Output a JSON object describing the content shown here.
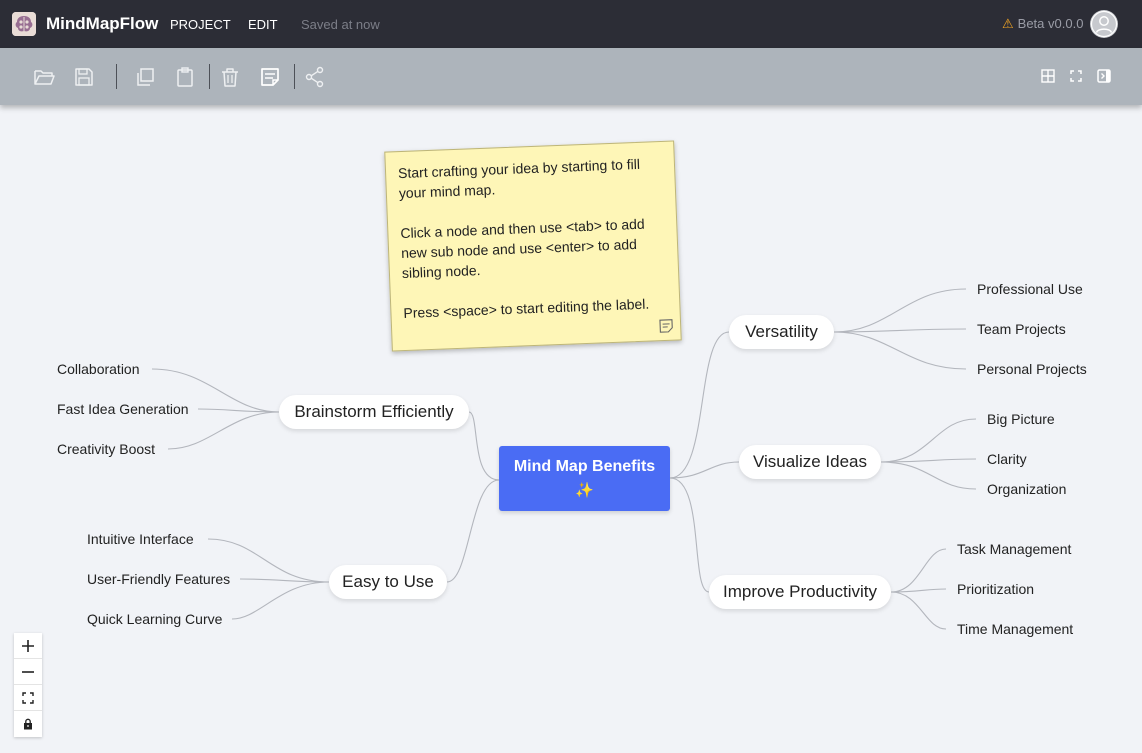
{
  "header": {
    "app_name": "MindMapFlow",
    "menu": [
      "PROJECT",
      "EDIT"
    ],
    "save_status": "Saved at now",
    "version": "Beta v0.0.0"
  },
  "toolbar": {
    "left_icons": [
      "folder-open-icon",
      "save-icon",
      "copy-icon",
      "paste-icon",
      "delete-icon",
      "note-icon",
      "share-icon"
    ],
    "right_icons": [
      "grid-icon",
      "fullscreen-icon",
      "panel-toggle-icon"
    ]
  },
  "note": {
    "line1": "Start crafting your idea by starting to fill your mind map.",
    "line2": "Click a node and then use <tab> to add new sub node and use <enter> to add sibling node.",
    "line3": "Press <space>  to start editing the label."
  },
  "mindmap": {
    "root": {
      "label": "Mind Map Benefits",
      "emoji": "✨"
    },
    "branches": {
      "brainstorm": {
        "label": "Brainstorm Efficiently",
        "children": [
          "Collaboration",
          "Fast Idea Generation",
          "Creativity Boost"
        ]
      },
      "easy": {
        "label": "Easy to Use",
        "children": [
          "Intuitive Interface",
          "User-Friendly Features",
          "Quick Learning Curve"
        ]
      },
      "versatility": {
        "label": "Versatility",
        "children": [
          "Professional Use",
          "Team Projects",
          "Personal Projects"
        ]
      },
      "visualize": {
        "label": "Visualize Ideas",
        "children": [
          "Big Picture",
          "Clarity",
          "Organization"
        ]
      },
      "productivity": {
        "label": "Improve Productivity",
        "children": [
          "Task Management",
          "Prioritization",
          "Time Management"
        ]
      }
    }
  },
  "zoom_controls": [
    "zoom-in-icon",
    "zoom-out-icon",
    "fit-view-icon",
    "lock-icon"
  ],
  "colors": {
    "topbar": "#2c2d36",
    "toolbar": "#adb4bb",
    "canvas": "#f1f3f7",
    "root": "#4a6cf4",
    "note": "#fef6b7"
  }
}
